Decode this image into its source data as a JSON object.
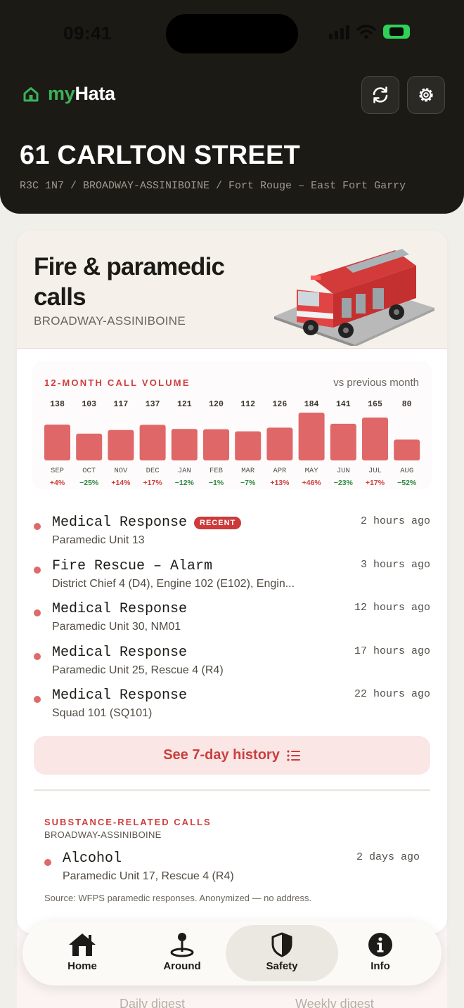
{
  "status_bar": {
    "time": "09:41"
  },
  "header": {
    "brand_my": "my",
    "brand_hata": "Hata",
    "address": "61 CARLTON STREET",
    "breadcrumb": "R3C 1N7 / BROADWAY-ASSINIBOINE / Fort Rouge – East Fort Garry",
    "icons": [
      "home-icon",
      "refresh-icon",
      "gear-icon"
    ]
  },
  "card": {
    "title": "Fire & paramedic calls",
    "subtitle": "BROADWAY-ASSINIBOINE",
    "chart_title": "12-MONTH CALL VOLUME",
    "chart_legend": "vs previous month",
    "colors": {
      "bar": "#e06767",
      "positive": "#cf3f3f",
      "negative": "#2f8a45"
    }
  },
  "chart_data": {
    "type": "bar",
    "title": "12-MONTH CALL VOLUME",
    "categories": [
      "SEP",
      "OCT",
      "NOV",
      "DEC",
      "JAN",
      "FEB",
      "MAR",
      "APR",
      "MAY",
      "JUN",
      "JUL",
      "AUG"
    ],
    "values": [
      138,
      103,
      117,
      137,
      121,
      120,
      112,
      126,
      184,
      141,
      165,
      80
    ],
    "changes": [
      "+4%",
      "−25%",
      "+14%",
      "+17%",
      "−12%",
      "−1%",
      "−7%",
      "+13%",
      "+46%",
      "−23%",
      "+17%",
      "−52%"
    ],
    "ylim": [
      0,
      184
    ],
    "legend": "vs previous month"
  },
  "calls": [
    {
      "type": "Medical Response",
      "badge": "RECENT",
      "units": "Paramedic Unit 13",
      "time": "2 hours ago"
    },
    {
      "type": "Fire Rescue – Alarm",
      "badge": "",
      "units": "District Chief 4 (D4), Engine 102 (E102), Engin...",
      "time": "3 hours ago"
    },
    {
      "type": "Medical Response",
      "badge": "",
      "units": "Paramedic Unit 30, NM01",
      "time": "12 hours ago"
    },
    {
      "type": "Medical Response",
      "badge": "",
      "units": "Paramedic Unit 25, Rescue 4 (R4)",
      "time": "17 hours ago"
    },
    {
      "type": "Medical Response",
      "badge": "",
      "units": "Squad 101 (SQ101)",
      "time": "22 hours ago"
    }
  ],
  "history_button": {
    "label": "See 7-day history",
    "icon": "list-icon"
  },
  "substance": {
    "title": "SUBSTANCE-RELATED CALLS",
    "area": "BROADWAY-ASSINIBOINE",
    "call": {
      "type": "Alcohol",
      "units": "Paramedic Unit 17, Rescue 4 (R4)",
      "time": "2 days ago"
    },
    "source": "Source: WFPS paramedic responses. Anonymized — no address."
  },
  "below": {
    "daily": "Daily digest",
    "weekly": "Weekly digest"
  },
  "tabs": [
    {
      "label": "Home",
      "icon": "house-icon",
      "active": false
    },
    {
      "label": "Around",
      "icon": "map-pin-icon",
      "active": false
    },
    {
      "label": "Safety",
      "icon": "shield-icon",
      "active": true
    },
    {
      "label": "Info",
      "icon": "info-icon",
      "active": false
    }
  ]
}
